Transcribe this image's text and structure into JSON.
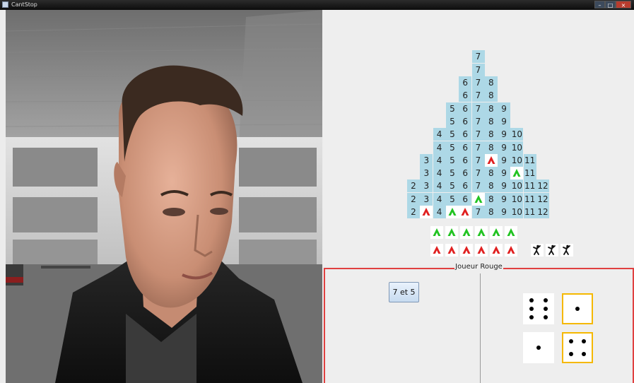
{
  "window": {
    "title": "CantStop"
  },
  "board": {
    "columns": [
      {
        "label": "2",
        "height": 3
      },
      {
        "label": "3",
        "height": 5
      },
      {
        "label": "4",
        "height": 7
      },
      {
        "label": "5",
        "height": 9
      },
      {
        "label": "6",
        "height": 11
      },
      {
        "label": "7",
        "height": 13
      },
      {
        "label": "8",
        "height": 11
      },
      {
        "label": "9",
        "height": 9
      },
      {
        "label": "10",
        "height": 7
      },
      {
        "label": "11",
        "height": 5
      },
      {
        "label": "12",
        "height": 3
      }
    ],
    "pieces": [
      {
        "column": "3",
        "row": 1,
        "color": "red"
      },
      {
        "column": "5",
        "row": 1,
        "color": "green"
      },
      {
        "column": "6",
        "row": 1,
        "color": "red"
      },
      {
        "column": "7",
        "row": 2,
        "color": "green"
      },
      {
        "column": "8",
        "row": 5,
        "color": "red"
      },
      {
        "column": "10",
        "row": 4,
        "color": "green"
      }
    ],
    "tray_green": 6,
    "tray_red": 6,
    "climbers": 3
  },
  "player_panel": {
    "title": "Joueur Rouge",
    "choice_button": "7 et 5",
    "dice": [
      {
        "value": 6,
        "selected": false
      },
      {
        "value": 1,
        "selected": true
      },
      {
        "value": 1,
        "selected": false
      },
      {
        "value": 4,
        "selected": true
      }
    ]
  },
  "colors": {
    "cell": "#add8e6",
    "pawn_red": "#e02020",
    "pawn_green": "#22c322",
    "panel_border": "#e04040",
    "die_selected": "#f5b800"
  }
}
